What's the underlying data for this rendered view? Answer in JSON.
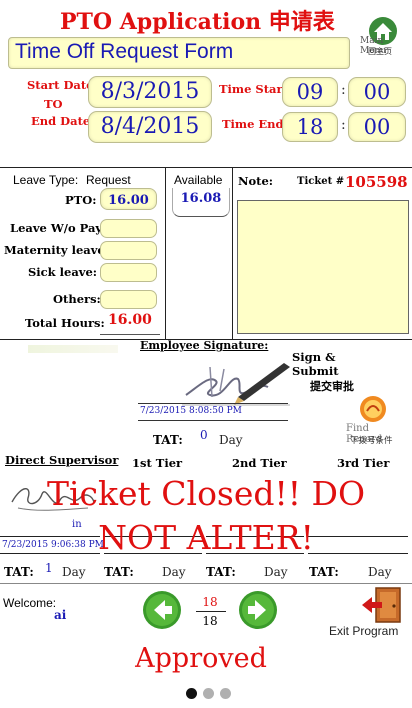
{
  "header": {
    "title": "PTO Application 申请表",
    "form_title": "Time Off Request Form",
    "main_menu_label": "Main Menu",
    "main_menu_sub": "回主页"
  },
  "dates": {
    "start_label": "Start Date:",
    "to_label": "TO",
    "end_label": "End Date:",
    "start_value": "8/3/2015",
    "end_value": "8/4/2015",
    "time_start_label": "Time Start",
    "time_end_label": "Time End",
    "time_start_hour": "09",
    "time_start_min": "00",
    "time_end_hour": "18",
    "time_end_min": "00",
    "colon": ":"
  },
  "leave": {
    "type_label": "Leave Type:",
    "type_value": "Request",
    "available_label": "Available",
    "available_value": "16.08",
    "note_label": "Note:",
    "ticket_label": "Ticket #",
    "ticket_value": "105598",
    "pto_label": "PTO:",
    "pto_value": "16.00",
    "wo_pay_label": "Leave W/o Pay:",
    "maternity_label": "Maternity leave:",
    "sick_label": "Sick leave:",
    "others_label": "Others:",
    "total_label": "Total Hours:",
    "total_value": "16.00"
  },
  "signature": {
    "employee_sig_label": "Employee Signature:",
    "sig_timestamp": "7/23/2015 8:08:50 PM",
    "sign_submit_label": "Sign & Submit",
    "sign_submit_sub": "提交审批",
    "find_record_label": "Find Record",
    "find_record_sub": "下拨号条件",
    "tat_label": "TAT:",
    "tat_value": "0",
    "day_label": "Day"
  },
  "approval": {
    "direct_supervisor_label": "Direct Supervisor",
    "tier1_label": "1st Tier",
    "tier2_label": "2nd Tier",
    "tier3_label": "3rd Tier",
    "closed_banner": "Ticket Closed!! DO NOT ALTER!",
    "supervisor_in": "in",
    "supervisor_timestamp": "7/23/2015 9:06:38 PM",
    "tat_label": "TAT:",
    "tat_values": [
      "1",
      "",
      "",
      ""
    ],
    "day_label": "Day"
  },
  "footer": {
    "welcome_label": "Welcome:",
    "welcome_user": "ai",
    "page_current": "18",
    "page_total": "18",
    "exit_label": "Exit Program",
    "status": "Approved",
    "page_dots": 3,
    "active_dot": 0
  },
  "colors": {
    "accent_red": "#e01010",
    "value_blue": "#1a1ab4",
    "field_fill": "#ffffc8",
    "nav_green": "#3a9a2a"
  }
}
